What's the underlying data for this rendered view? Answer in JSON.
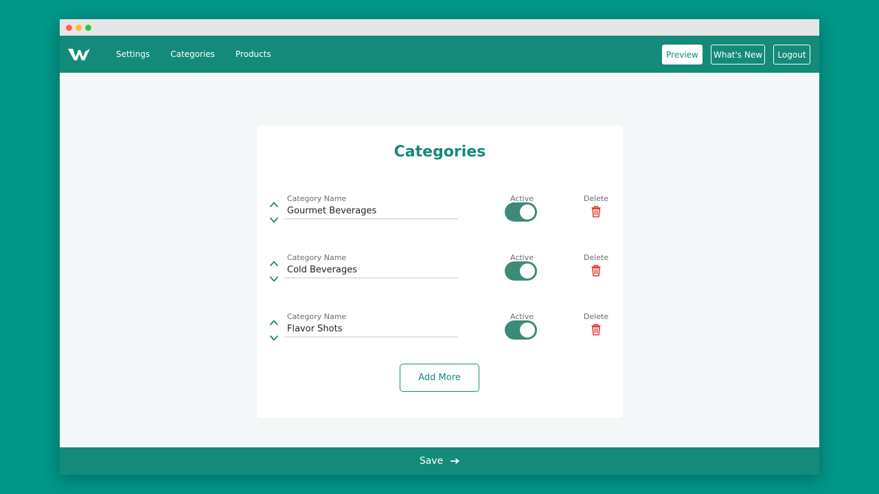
{
  "nav": {
    "links": [
      "Settings",
      "Categories",
      "Products"
    ],
    "actions": [
      "Preview",
      "What's New",
      "Logout"
    ]
  },
  "card": {
    "title": "Categories",
    "field_label": "Category Name",
    "active_label": "Active",
    "delete_label": "Delete",
    "rows": [
      {
        "name": "Gourmet Beverages",
        "active": true
      },
      {
        "name": "Cold Beverages",
        "active": true
      },
      {
        "name": "Flavor Shots",
        "active": true
      }
    ],
    "add_more_label": "Add More"
  },
  "footer": {
    "save_label": "Save"
  },
  "icons": {
    "logo": "logo-w-icon",
    "up": "chevron-up-icon",
    "down": "chevron-down-icon",
    "delete": "trash-icon",
    "save": "arrow-right-icon"
  },
  "colors": {
    "background": "#009688",
    "primary": "#148a7a",
    "toggle": "#3c8a78",
    "danger": "#e53935"
  }
}
